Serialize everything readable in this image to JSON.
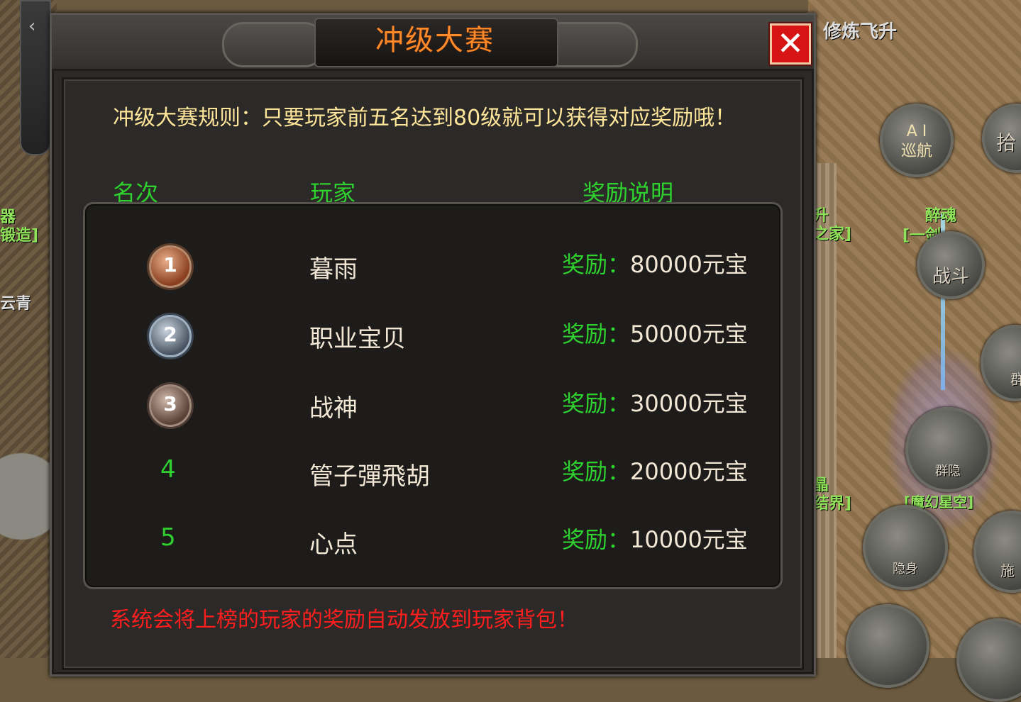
{
  "game_bg": {
    "top_right_label": "修炼飞升",
    "ai_button": {
      "top": "A I",
      "bottom": "巡航"
    },
    "pickup_button": "拾",
    "fight_button": "战斗",
    "group_hide_button": "群隐",
    "hide_button": "隐身",
    "cast_button": "施",
    "group_button": "群",
    "left_labels": [
      "器",
      "锻造]",
      "云青"
    ],
    "right_labels": [
      "升",
      "之家]",
      "醉魂",
      "[一剑",
      "晶",
      "结界]",
      "[魔幻星空]"
    ]
  },
  "dialog": {
    "title": "冲级大赛",
    "close_symbol": "✕",
    "rules": "冲级大赛规则：只要玩家前五名达到80级就可以获得对应奖励哦！",
    "columns": {
      "rank": "名次",
      "player": "玩家",
      "reward": "奖励说明"
    },
    "rows": [
      {
        "rank": "1",
        "player": "暮雨",
        "reward_label": "奖励：",
        "reward_value": "80000元宝"
      },
      {
        "rank": "2",
        "player": "职业宝贝",
        "reward_label": "奖励：",
        "reward_value": "50000元宝"
      },
      {
        "rank": "3",
        "player": "战神",
        "reward_label": "奖励：",
        "reward_value": "30000元宝"
      },
      {
        "rank": "4",
        "player": "管子彈飛胡",
        "reward_label": "奖励：",
        "reward_value": "20000元宝"
      },
      {
        "rank": "5",
        "player": "心点",
        "reward_label": "奖励：",
        "reward_value": "10000元宝"
      }
    ],
    "footer": "系统会将上榜的玩家的奖励自动发放到玩家背包！"
  },
  "colors": {
    "title": "#ff8a2a",
    "rules": "#ffe59a",
    "header_green": "#2ed12e",
    "footer_red": "#ff1e1e",
    "close_bg": "#d61414"
  }
}
